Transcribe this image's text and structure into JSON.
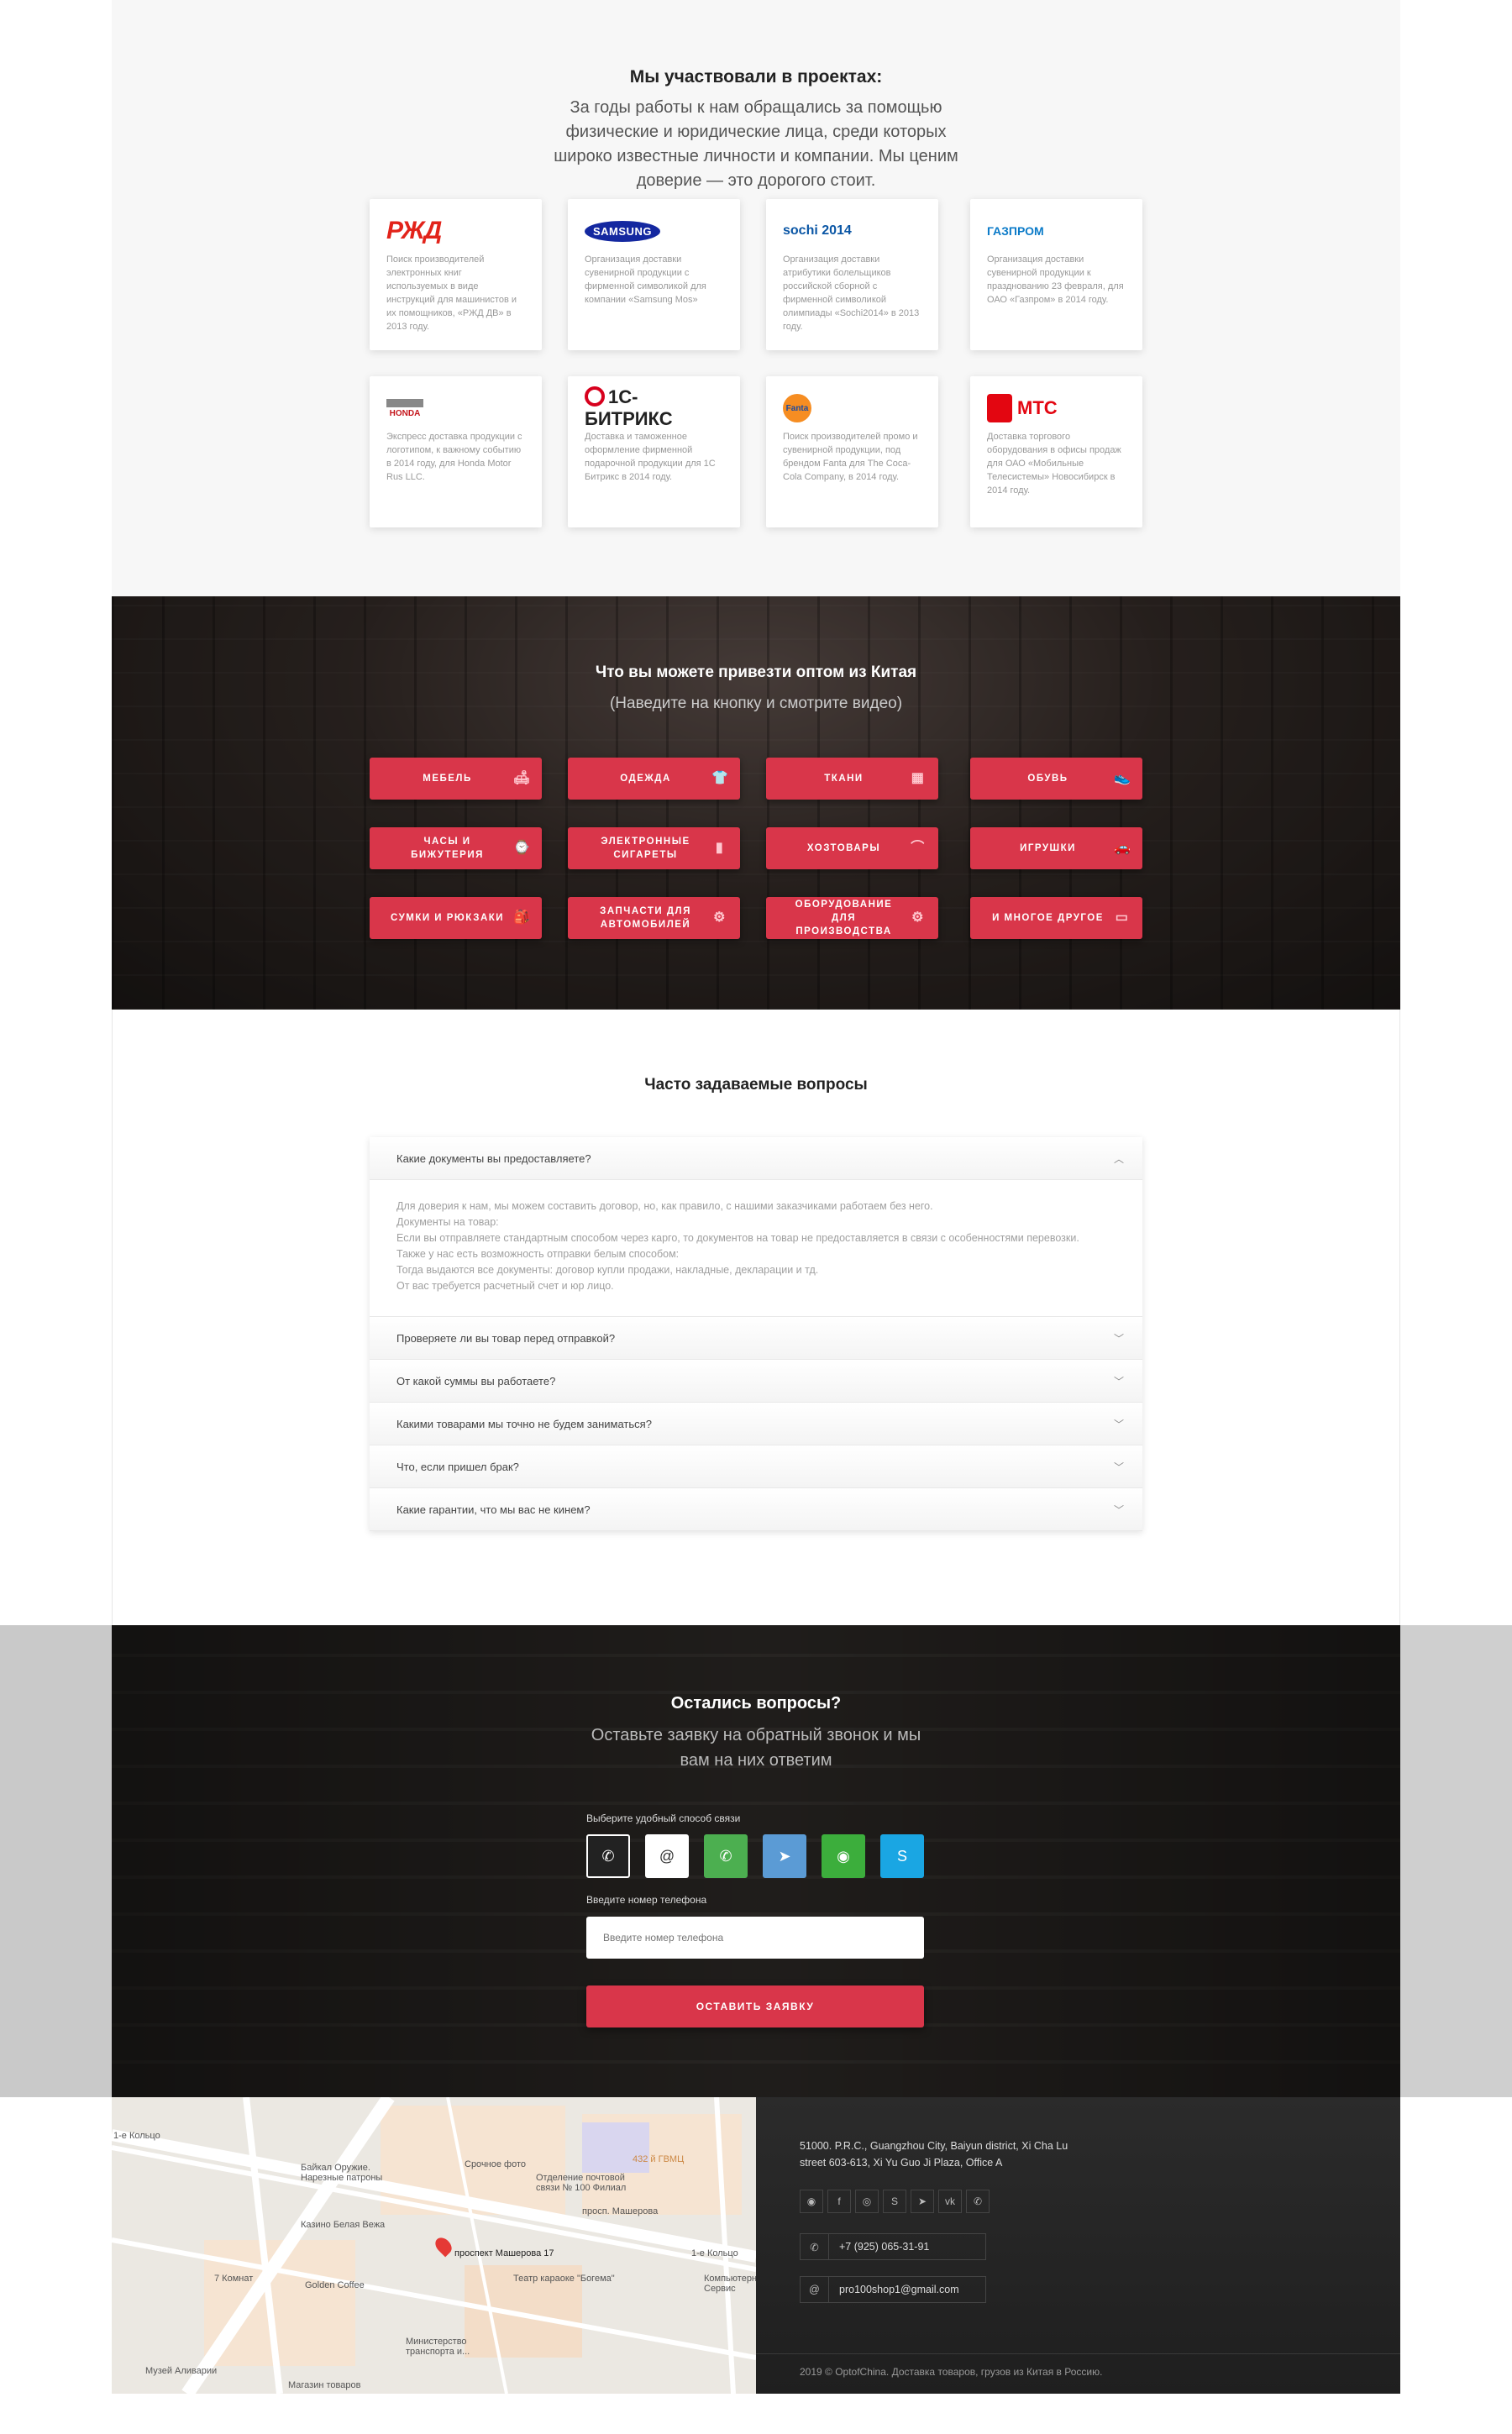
{
  "projects": {
    "title": "Мы участвовали в проектах:",
    "lead": "За годы работы к нам обращались за помощью физические и юридические лица, среди которых широко известные личности и компании. Мы ценим доверие — это дорогого стоит.",
    "cards": [
      {
        "logo": "РЖД",
        "logo_icon": "rzd-logo",
        "text": "Поиск производителей электронных книг используемых в виде инструкций для машинистов и их помощников, «РЖД ДВ» в 2013 году."
      },
      {
        "logo": "SAMSUNG",
        "logo_icon": "samsung-logo",
        "text": "Организация доставки сувенирной продукции с фирменной символикой для компании «Samsung Mos»"
      },
      {
        "logo": "sochi 2014",
        "logo_icon": "sochi-logo",
        "text": "Организация доставки атрибутики болельщиков российской сборной с фирменной символикой олимпиады «Sochi2014» в 2013 году."
      },
      {
        "logo": "ГАЗПРОМ",
        "logo_icon": "gazprom-logo",
        "text": "Организация доставки сувенирной продукции к празднованию 23 февраля, для ОАО «Газпром» в 2014 году."
      },
      {
        "logo": "HONDA",
        "logo_icon": "honda-logo",
        "text": "Экспресс доставка продукции с логотипом, к важному событию в 2014 году, для Honda Motor Rus LLC."
      },
      {
        "logo": "1С-БИТРИКС",
        "logo_icon": "bitrix-logo",
        "text": "Доставка и таможенное оформление фирменной подарочной продукции для 1С Битрикс в 2014 году."
      },
      {
        "logo": "Fanta",
        "logo_icon": "fanta-logo",
        "text": "Поиск производителей промо и сувенирной продукции, под брендом Fanta для The Coca-Cola Company, в 2014 году."
      },
      {
        "logo": "МТС",
        "logo_icon": "mts-logo",
        "text": "Доставка торгового оборудования в офисы продаж для ОАО «Мобильные Телесистемы» Новосибирск в 2014 году."
      }
    ]
  },
  "categories": {
    "title": "Что вы можете привезти оптом из Китая",
    "subtitle": "(Наведите на кнопку и смотрите видео)",
    "items": [
      {
        "label": "Мебель",
        "icon": "sofa-icon",
        "glyph": "🛋"
      },
      {
        "label": "Одежда",
        "icon": "shirt-icon",
        "glyph": "👕"
      },
      {
        "label": "Ткани",
        "icon": "fabric-icon",
        "glyph": "▦"
      },
      {
        "label": "Обувь",
        "icon": "shoe-icon",
        "glyph": "👟"
      },
      {
        "label": "Часы и бижутерия",
        "icon": "watch-icon",
        "glyph": "⌚"
      },
      {
        "label": "Электронные сигареты",
        "icon": "vape-icon",
        "glyph": "▮"
      },
      {
        "label": "Хозтовары",
        "icon": "hanger-icon",
        "glyph": "⌒"
      },
      {
        "label": "Игрушки",
        "icon": "toy-car-icon",
        "glyph": "🚗"
      },
      {
        "label": "Сумки и рюкзаки",
        "icon": "backpack-icon",
        "glyph": "🎒"
      },
      {
        "label": "Запчасти для автомобилей",
        "icon": "engine-icon",
        "glyph": "⚙"
      },
      {
        "label": "Оборудование для производства",
        "icon": "machine-icon",
        "glyph": "⚙"
      },
      {
        "label": "И многое другое",
        "icon": "box-icon",
        "glyph": "▭"
      }
    ]
  },
  "faq": {
    "title": "Часто задаваемые вопросы",
    "open_question": "Какие документы вы предоставляете?",
    "answer_lines": [
      "Для доверия к нам, мы можем составить договор, но, как правило, с нашими заказчиками работаем без него.",
      "Документы на товар:",
      "Если вы отправляете стандартным способом через карго, то документов на товар не предоставляется в связи с особенностями перевозки.",
      "Также у нас есть возможность отправки белым способом:",
      "Тогда выдаются все документы: договор купли продажи, накладные, декларации и тд.",
      "От вас требуется расчетный счет и юр лицо."
    ],
    "questions": [
      "Проверяете ли вы товар перед отправкой?",
      "От какой суммы вы работаете?",
      "Какими товарами мы точно не будем заниматься?",
      "Что, если пришел брак?",
      "Какие гарантии, что мы вас не кинем?"
    ]
  },
  "contact": {
    "title": "Остались вопросы?",
    "subtitle": "Оставьте заявку на обратный звонок и мы вам на них ответим",
    "method_label": "Выберите удобный способ связи",
    "methods": [
      {
        "icon": "phone-icon",
        "glyph": "✆",
        "bg": "#222222",
        "selected": true
      },
      {
        "icon": "email-icon",
        "glyph": "@",
        "bg": "#ffffff"
      },
      {
        "icon": "whatsapp-icon",
        "glyph": "✆",
        "bg": "#4caf50"
      },
      {
        "icon": "telegram-icon",
        "glyph": "➤",
        "bg": "#5b9bd5"
      },
      {
        "icon": "wechat-icon",
        "glyph": "◉",
        "bg": "#3cae3c"
      },
      {
        "icon": "skype-icon",
        "glyph": "S",
        "bg": "#1aa6e3"
      }
    ],
    "phone_label": "Введите номер телефона",
    "phone_placeholder": "Введите номер телефона",
    "submit": "ОСТАВИТЬ ЗАЯВКУ"
  },
  "map": {
    "labels": [
      "1-е Кольцо",
      "Срочное фото",
      "Байкал Оружие. Нарезные патроны",
      "432 й ГВМЦ",
      "Отделение почтовой связи № 100 Филиал",
      "просп. Машерова",
      "Казино Белая Вежа",
      "проспект Машерова 17",
      "1-е Кольцо",
      "7 Комнат",
      "Golden Coffee",
      "Театр караоке \"Богема\"",
      "Компьютерный Сервис",
      "Министерство транспорта и...",
      "Музей Аливарии",
      "Магазин товаров"
    ]
  },
  "footer": {
    "address_line1": "51000. P.R.C., Guangzhou City, Baiyun district, Xi Cha Lu",
    "address_line2": "street 603-613, Xi Yu Guo Ji Plaza, Office A",
    "social": [
      {
        "icon": "wechat-icon",
        "glyph": "◉"
      },
      {
        "icon": "facebook-icon",
        "glyph": "f"
      },
      {
        "icon": "instagram-icon",
        "glyph": "◎"
      },
      {
        "icon": "skype-icon",
        "glyph": "S"
      },
      {
        "icon": "telegram-icon",
        "glyph": "➤"
      },
      {
        "icon": "vk-icon",
        "glyph": "vk"
      },
      {
        "icon": "whatsapp-icon",
        "glyph": "✆"
      }
    ],
    "phone": "+7 (925) 065-31-91",
    "email": "pro100shop1@gmail.com",
    "copyright": "2019 © OptofChina. Доставка товаров, грузов из Китая в Россию."
  },
  "colors": {
    "accent": "#d9364a",
    "dark": "#222222"
  }
}
